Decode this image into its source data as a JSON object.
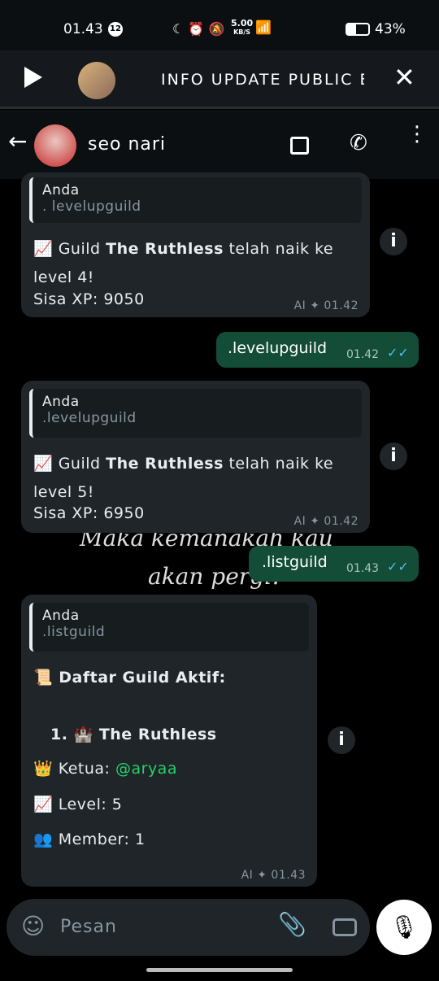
{
  "status": {
    "time": "01.43",
    "notif_count": "12",
    "speed": "5.00",
    "speed_unit": "KB/S",
    "battery": "43%"
  },
  "banner": {
    "title": "INFO UPDATE PUBLIC BOT"
  },
  "header": {
    "contact": "seo nari"
  },
  "background_lyrics": [
    "Maka kemanakah kau",
    "akan pergi?"
  ],
  "messages": [
    {
      "type": "in",
      "quote_name": "Anda",
      "quote_text": ". levelupguild",
      "lines": [
        "📈 Guild ",
        "The Ruthless",
        " telah naik ke",
        "level 4!",
        "Sisa XP: 9050"
      ],
      "time": "AI ✦ 01.42"
    },
    {
      "type": "out",
      "text": ".levelupguild",
      "time": "01.42"
    },
    {
      "type": "in",
      "quote_name": "Anda",
      "quote_text": ".levelupguild",
      "lines": [
        "📈 Guild ",
        "The Ruthless",
        " telah naik ke",
        "level 5!",
        "Sisa XP: 6950"
      ],
      "time": "AI ✦ 01.42"
    },
    {
      "type": "out",
      "text": ".listguild",
      "time": "01.43"
    },
    {
      "type": "in",
      "quote_name": "Anda",
      "quote_text": ".listguild",
      "title": "📜 Daftar Guild Aktif:",
      "item": "1. 🏰 The Ruthless",
      "ketua_label": "👑 Ketua: ",
      "ketua": "@aryaa",
      "level": "📈 Level: 5",
      "member": "👥 Member: 1",
      "time": "AI ✦ 01.43"
    }
  ],
  "input": {
    "placeholder": "Pesan"
  },
  "colors": {
    "outgoing": "#134d37",
    "incoming": "#1f2529",
    "mention": "#25d366",
    "ticks": "#53bdeb"
  }
}
